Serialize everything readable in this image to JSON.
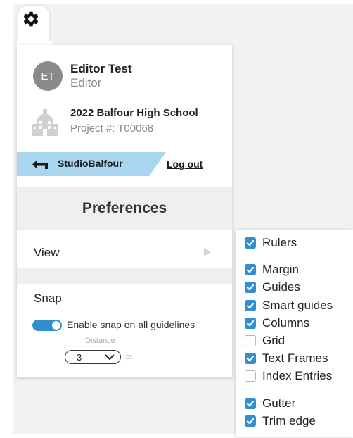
{
  "colors": {
    "accent": "#2f8fd1",
    "studio_button": "#a9d6ee",
    "section_bg": "#efefef",
    "muted": "#8a8a8a"
  },
  "icons": [
    "gear-icon",
    "school-icon",
    "back-arrow-icon",
    "view-arrow-icon",
    "chevron-down-icon",
    "check-icon"
  ],
  "user": {
    "initials": "ET",
    "name": "Editor Test",
    "role": "Editor"
  },
  "project": {
    "name": "2022 Balfour High School",
    "number": "Project #: T00068"
  },
  "nav": {
    "studio_label": "StudioBalfour",
    "logout_label": "Log out"
  },
  "preferences": {
    "title": "Preferences",
    "view_label": "View",
    "snap": {
      "label": "Snap",
      "toggle_on": true,
      "toggle_label": "Enable snap on all guidelines",
      "distance_label": "Distance",
      "distance_value": "3",
      "unit": "pt"
    }
  },
  "view_menu": {
    "items": [
      {
        "label": "Rulers",
        "checked": true
      },
      {
        "label": "Margin",
        "checked": true
      },
      {
        "label": "Guides",
        "checked": true
      },
      {
        "label": "Smart guides",
        "checked": true
      },
      {
        "label": "Columns",
        "checked": true
      },
      {
        "label": "Grid",
        "checked": false
      },
      {
        "label": "Text Frames",
        "checked": true
      },
      {
        "label": "Index Entries",
        "checked": false
      },
      {
        "label": "Gutter",
        "checked": true
      },
      {
        "label": "Trim edge",
        "checked": true
      }
    ]
  }
}
